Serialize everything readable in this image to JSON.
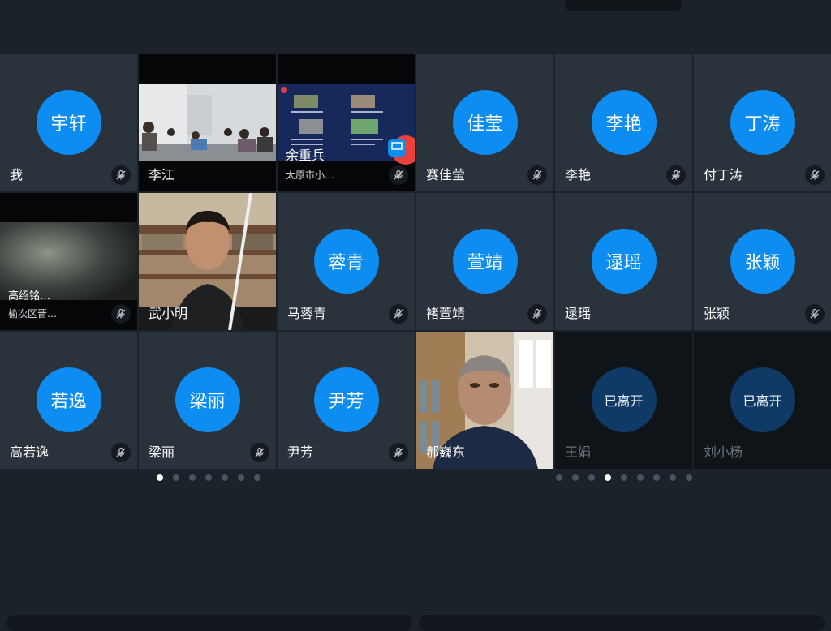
{
  "participants_left": [
    {
      "type": "avatar",
      "avatar_text": "宇轩",
      "name": "我",
      "muted": true
    },
    {
      "type": "video",
      "scene": "classroom",
      "name": "李江",
      "muted": false
    },
    {
      "type": "video",
      "scene": "screen-share",
      "name": "余重兵",
      "sub": "太原市小…",
      "muted": true,
      "sharing": true
    },
    {
      "type": "video",
      "scene": "dark-room",
      "name": "高绍铭…",
      "sub": "榆次区晋…",
      "muted": true
    },
    {
      "type": "video",
      "scene": "man-office",
      "name": "武小明",
      "muted": false
    },
    {
      "type": "avatar",
      "avatar_text": "蓉青",
      "name": "马蓉青",
      "muted": true
    },
    {
      "type": "avatar",
      "avatar_text": "若逸",
      "name": "高若逸",
      "muted": true
    },
    {
      "type": "avatar",
      "avatar_text": "梁丽",
      "name": "梁丽",
      "muted": true
    },
    {
      "type": "avatar",
      "avatar_text": "尹芳",
      "name": "尹芳",
      "muted": true
    }
  ],
  "participants_right": [
    {
      "type": "avatar",
      "avatar_text": "佳莹",
      "name": "赛佳莹",
      "muted": true
    },
    {
      "type": "avatar",
      "avatar_text": "李艳",
      "name": "李艳",
      "muted": true
    },
    {
      "type": "avatar",
      "avatar_text": "丁涛",
      "name": "付丁涛",
      "muted": true
    },
    {
      "type": "avatar",
      "avatar_text": "萱靖",
      "name": "褚萱靖",
      "muted": true
    },
    {
      "type": "avatar",
      "avatar_text": "逯瑶",
      "name": "逯瑶",
      "muted": false
    },
    {
      "type": "avatar",
      "avatar_text": "张颖",
      "name": "张颖",
      "muted": true
    },
    {
      "type": "video",
      "scene": "man-bookshelf",
      "name": "郝巍东",
      "muted": false
    },
    {
      "type": "left",
      "avatar_text": "已离开",
      "name": "王娟",
      "muted": false
    },
    {
      "type": "left",
      "avatar_text": "已离开",
      "name": "刘小杨",
      "muted": false
    }
  ],
  "pagination_left": {
    "count": 7,
    "active": 0
  },
  "pagination_right": {
    "count": 9,
    "active": 3
  },
  "colors": {
    "avatar": "#0d8cf2",
    "avatar_left": "#0f3a66",
    "tile": "#2a323b",
    "background": "#1b222a"
  }
}
